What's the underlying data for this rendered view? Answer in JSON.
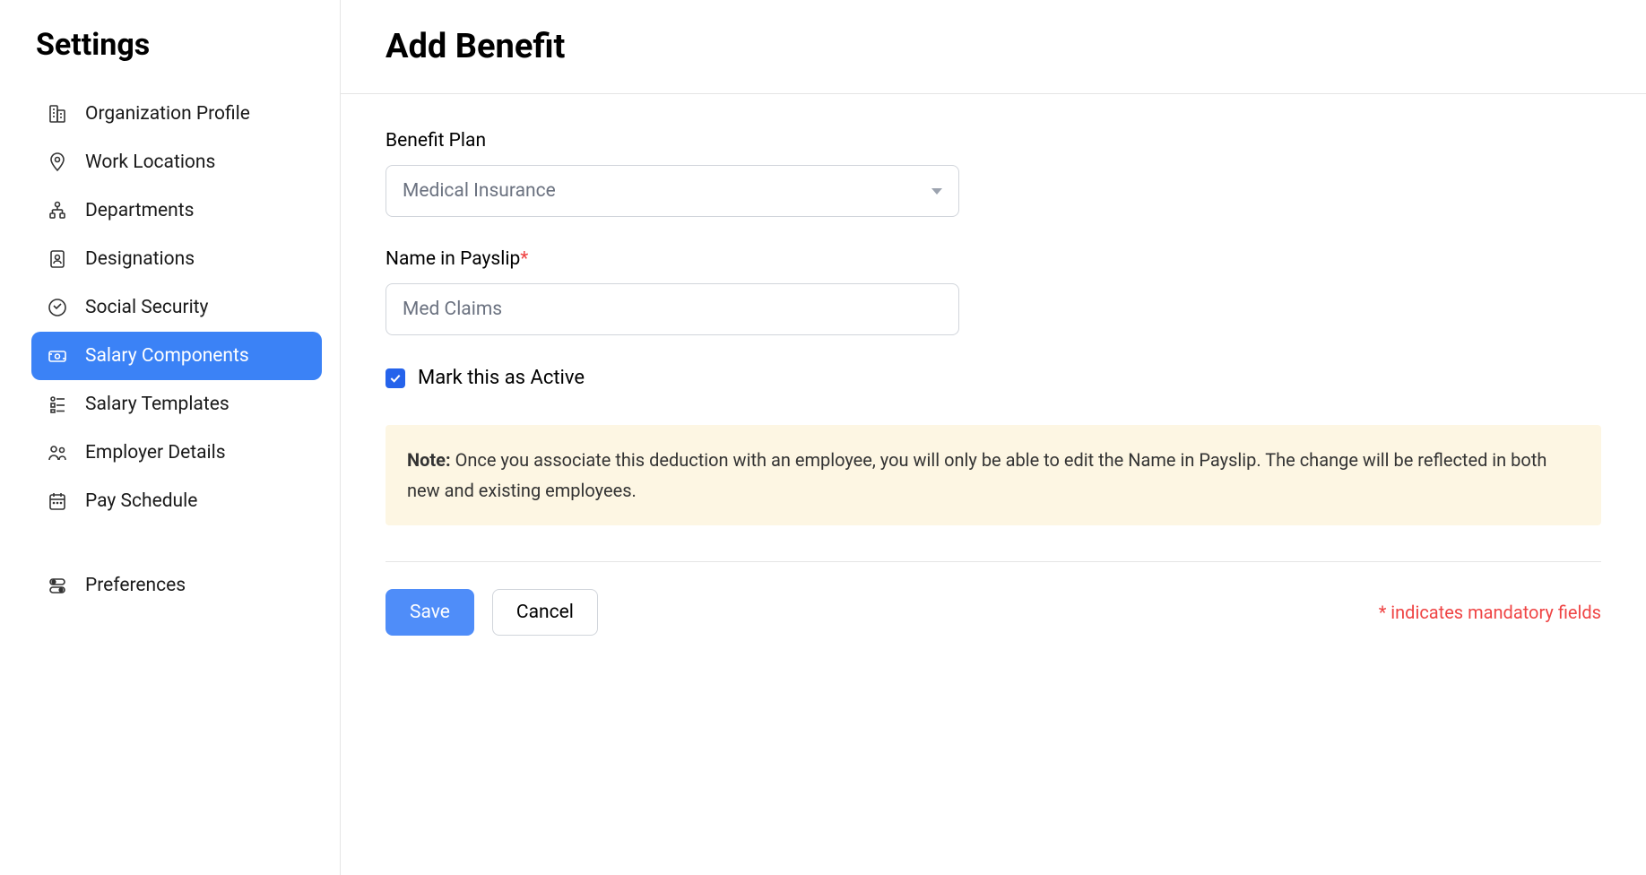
{
  "sidebar": {
    "title": "Settings",
    "items": [
      {
        "label": "Organization Profile"
      },
      {
        "label": "Work Locations"
      },
      {
        "label": "Departments"
      },
      {
        "label": "Designations"
      },
      {
        "label": "Social Security"
      },
      {
        "label": "Salary Components"
      },
      {
        "label": "Salary Templates"
      },
      {
        "label": "Employer Details"
      },
      {
        "label": "Pay Schedule"
      },
      {
        "label": "Preferences"
      }
    ]
  },
  "main": {
    "title": "Add Benefit",
    "benefitPlan": {
      "label": "Benefit Plan",
      "value": "Medical Insurance"
    },
    "nameInPayslip": {
      "label": "Name in Payslip",
      "value": "Med Claims"
    },
    "activeCheckbox": {
      "label": "Mark this as Active",
      "checked": true
    },
    "note": {
      "prefix": "Note:",
      "text": " Once you associate this deduction with an employee, you will only be able to edit the Name in Payslip. The change will be reflected in both new and existing employees."
    },
    "buttons": {
      "save": "Save",
      "cancel": "Cancel"
    },
    "mandatoryNote": "* indicates mandatory fields"
  }
}
